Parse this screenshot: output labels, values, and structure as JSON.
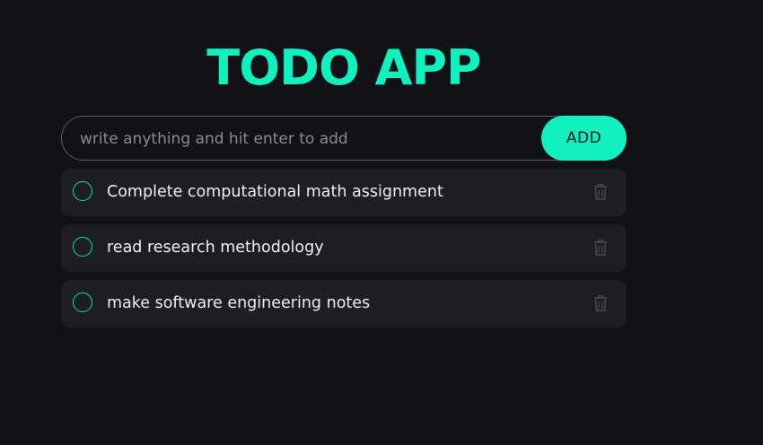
{
  "app": {
    "title": "TODO APP"
  },
  "input": {
    "placeholder": "write anything and hit enter to add",
    "value": "",
    "add_label": "ADD"
  },
  "todos": [
    {
      "text": "Complete computational math assignment",
      "done": false
    },
    {
      "text": "read research methodology",
      "done": false
    },
    {
      "text": "make software engineering notes",
      "done": false
    }
  ],
  "colors": {
    "background": "#111216",
    "accent": "#12f0c0",
    "item_background": "#1d1e22",
    "text": "#eeeeee",
    "trash_icon": "#4a4c50"
  },
  "icons": {
    "checkbox": "circle-outline-icon",
    "delete": "trash-icon"
  }
}
